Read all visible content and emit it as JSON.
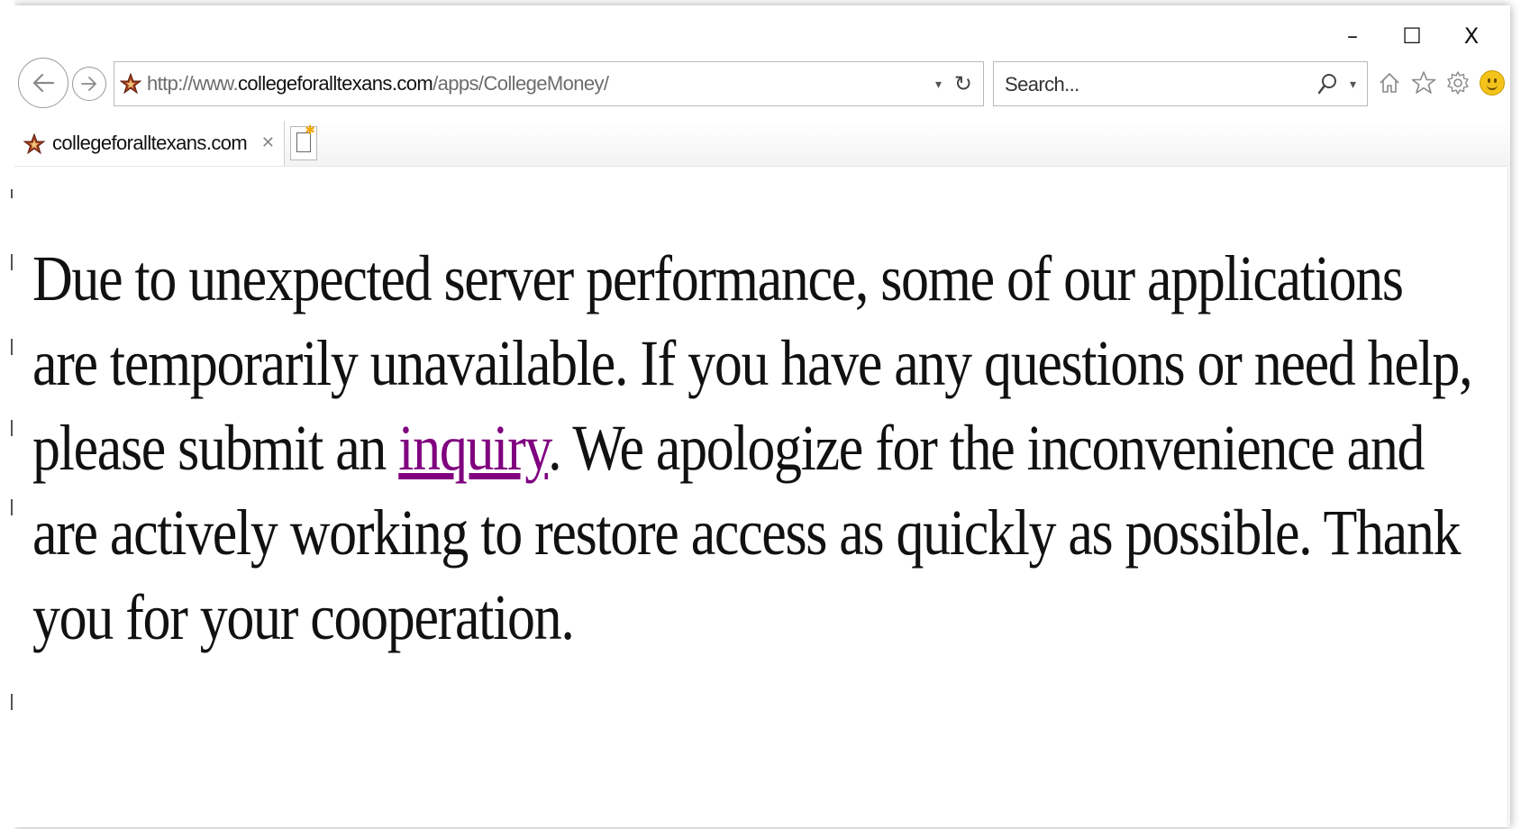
{
  "window": {
    "minimize": "–",
    "maximize": "☐",
    "close": "X"
  },
  "nav": {
    "back_icon": "back-arrow-icon",
    "forward_icon": "forward-arrow-icon",
    "address": {
      "prefix": "http://www.",
      "domain": "collegeforalltexans.com",
      "path": "/apps/CollegeMoney/"
    },
    "address_dropdown": "▾",
    "refresh": "↻",
    "search_placeholder": "Search...",
    "search_icon": "⚲",
    "search_dropdown": "▾",
    "toolbar": {
      "home": "⌂",
      "favorites": "☆",
      "settings": "⚙"
    }
  },
  "tab": {
    "title": "collegeforalltexans.com",
    "close": "✕",
    "new_tab_sparkle": "✱"
  },
  "content": {
    "text_before_link": "Due to unexpected server performance, some of our applications are temporarily unavailable. If you have any questions or need help, please submit an ",
    "link_text": "inquiry",
    "text_after_link": ". We apologize for the inconvenience and are actively working to restore access as quickly as possible. Thank you for your cooperation."
  },
  "colors": {
    "link_visited": "#800080",
    "star_fill": "#a0401f"
  }
}
